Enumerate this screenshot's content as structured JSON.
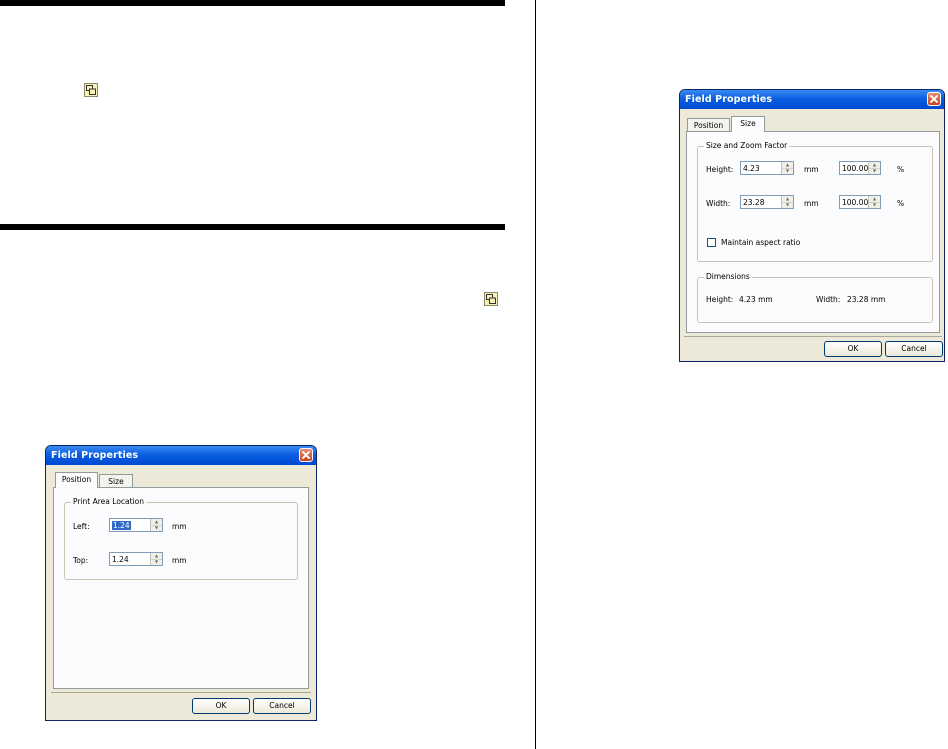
{
  "dialog_position": {
    "title": "Field Properties",
    "tabs": [
      "Position",
      "Size"
    ],
    "active_tab": "Position",
    "group_label": "Print Area Location",
    "fields": [
      {
        "label": "Left:",
        "value": "1.24",
        "unit": "mm"
      },
      {
        "label": "Top:",
        "value": "1.24",
        "unit": "mm"
      }
    ],
    "ok_label": "OK",
    "cancel_label": "Cancel"
  },
  "dialog_size": {
    "title": "Field Properties",
    "tabs": [
      "Position",
      "Size"
    ],
    "active_tab": "Size",
    "group_label": "Size and Zoom Factor",
    "fields": [
      {
        "label": "Height:",
        "value": "4.23",
        "unit": "mm",
        "zoom": "100.00",
        "zoom_unit": "%"
      },
      {
        "label": "Width:",
        "value": "23.28",
        "unit": "mm",
        "zoom": "100.00",
        "zoom_unit": "%"
      }
    ],
    "checkbox_label": "Maintain aspect ratio",
    "checkbox_checked": false,
    "dimensions_label": "Dimensions",
    "dimensions": {
      "height_label": "Height:",
      "height_value": "4.23 mm",
      "width_label": "Width:",
      "width_value": "23.28 mm"
    },
    "ok_label": "OK",
    "cancel_label": "Cancel"
  },
  "icons": [
    "field-properties-icon",
    "field-properties-icon"
  ],
  "colors": {
    "titlebar": "#0a5fe0",
    "dialog_bg": "#ece9d8",
    "selection": "#316ac5"
  }
}
